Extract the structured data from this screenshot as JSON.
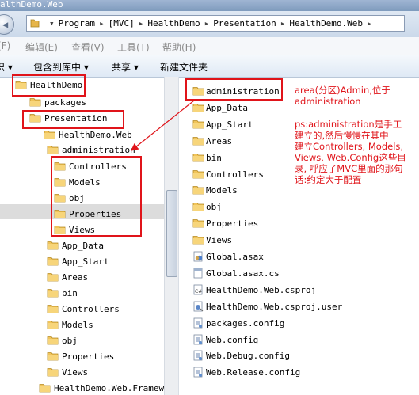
{
  "window": {
    "title_fragment": "althDemo.Web"
  },
  "address": {
    "crumbs": [
      "Program",
      "[MVC]",
      "HealthDemo",
      "Presentation",
      "HealthDemo.Web"
    ],
    "sep": "▸",
    "prefix": "▾"
  },
  "menu": {
    "items": [
      "(F)",
      "编辑(E)",
      "查看(V)",
      "工具(T)",
      "帮助(H)"
    ]
  },
  "toolbar": {
    "items": [
      "织 ▾",
      "包含到库中 ▾",
      "共享 ▾",
      "新建文件夹"
    ]
  },
  "tree": {
    "items": [
      {
        "label": "HealthDemo",
        "icon": "folder-icon"
      },
      {
        "label": "packages",
        "icon": "folder-icon"
      },
      {
        "label": "Presentation",
        "icon": "folder-icon"
      },
      {
        "label": "HealthDemo.Web",
        "icon": "folder-icon"
      },
      {
        "label": "administration",
        "icon": "folder-icon"
      },
      {
        "label": "Controllers",
        "icon": "folder-icon"
      },
      {
        "label": "Models",
        "icon": "folder-icon"
      },
      {
        "label": "obj",
        "icon": "folder-icon"
      },
      {
        "label": "Properties",
        "icon": "folder-icon"
      },
      {
        "label": "Views",
        "icon": "folder-icon"
      },
      {
        "label": "App_Data",
        "icon": "folder-icon"
      },
      {
        "label": "App_Start",
        "icon": "folder-icon"
      },
      {
        "label": "Areas",
        "icon": "folder-icon"
      },
      {
        "label": "bin",
        "icon": "folder-icon"
      },
      {
        "label": "Controllers",
        "icon": "folder-icon"
      },
      {
        "label": "Models",
        "icon": "folder-icon"
      },
      {
        "label": "obj",
        "icon": "folder-icon"
      },
      {
        "label": "Properties",
        "icon": "folder-icon"
      },
      {
        "label": "Views",
        "icon": "folder-icon"
      },
      {
        "label": "HealthDemo.Web.Framewor",
        "icon": "folder-icon"
      }
    ]
  },
  "files": {
    "items": [
      {
        "label": "administration",
        "icon": "folder-icon"
      },
      {
        "label": "App_Data",
        "icon": "folder-icon"
      },
      {
        "label": "App_Start",
        "icon": "folder-icon"
      },
      {
        "label": "Areas",
        "icon": "folder-icon"
      },
      {
        "label": "bin",
        "icon": "folder-icon"
      },
      {
        "label": "Controllers",
        "icon": "folder-icon"
      },
      {
        "label": "Models",
        "icon": "folder-icon"
      },
      {
        "label": "obj",
        "icon": "folder-icon"
      },
      {
        "label": "Properties",
        "icon": "folder-icon"
      },
      {
        "label": "Views",
        "icon": "folder-icon"
      },
      {
        "label": "Global.asax",
        "icon": "asax-file-icon"
      },
      {
        "label": "Global.asax.cs",
        "icon": "cs-file-icon"
      },
      {
        "label": "HealthDemo.Web.csproj",
        "icon": "csproj-file-icon"
      },
      {
        "label": "HealthDemo.Web.csproj.user",
        "icon": "user-file-icon"
      },
      {
        "label": "packages.config",
        "icon": "config-file-icon"
      },
      {
        "label": "Web.config",
        "icon": "config-file-icon"
      },
      {
        "label": "Web.Debug.config",
        "icon": "config-file-icon"
      },
      {
        "label": "Web.Release.config",
        "icon": "config-file-icon"
      }
    ]
  },
  "annotations": {
    "note1": [
      "area(分区)Admin,位于",
      "administration"
    ],
    "note2": [
      "ps:administration是手工",
      "建立的,然后慢慢在其中",
      "建立Controllers, Models,",
      "Views, Web.Config这些目",
      "录, 呼应了MVC里面的那句",
      "话:约定大于配置"
    ],
    "color": "#e0141a"
  }
}
